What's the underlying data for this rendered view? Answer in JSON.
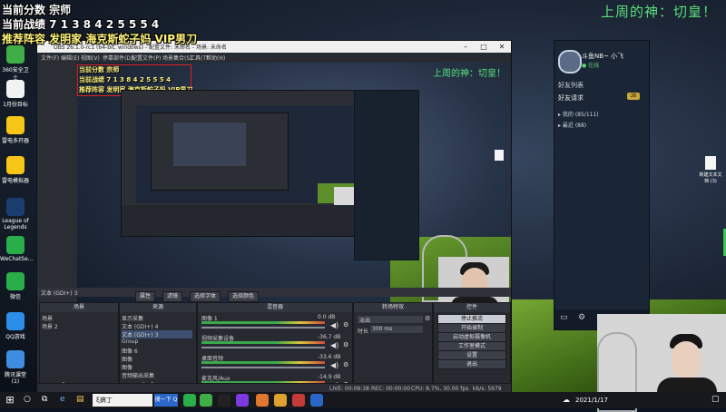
{
  "overlay": {
    "line1": "当前分数 宗师",
    "line2": "当前战绩 7 1 3 8 4 2 5 5 5 4",
    "line3": "推荐阵容 发明家 海克斯蛇子妈 VIP男刀",
    "slogan": "上周的神：切皇！"
  },
  "desktop_icons": [
    {
      "label": "360安全卫士",
      "icon": "security-icon",
      "color": "#3fae47"
    },
    {
      "label": "1月份目标",
      "icon": "document-icon",
      "color": "#f2f2f2"
    },
    {
      "label": "雷电多开器",
      "icon": "emulator-icon",
      "color": "#f5c518"
    },
    {
      "label": "雷电模拟器",
      "icon": "emulator-icon",
      "color": "#f5c518"
    },
    {
      "label": "League of Legends",
      "icon": "league-icon",
      "color": "#1b3d6e"
    },
    {
      "label": "WeChatSe...",
      "icon": "wechat-icon",
      "color": "#2aae4a"
    },
    {
      "label": "微信",
      "icon": "wechat-icon",
      "color": "#2aae4a"
    },
    {
      "label": "QQ游戏",
      "icon": "qq-icon",
      "color": "#2c8ee8"
    },
    {
      "label": "腾讯课堂 (1)",
      "icon": "app-icon",
      "color": "#3e8de0"
    }
  ],
  "obs": {
    "title": "OBS 26.1.0-rc1 (64-bit, windows) - 配置文件: 未命名 - 场景: 未命名",
    "menu": [
      "文件(F)",
      "编辑(E)",
      "视图(V)",
      "停靠部件(D)",
      "配置文件(P)",
      "场景集合(S)",
      "工具(T)",
      "帮助(H)"
    ],
    "source_label": "文本 (GDI+) 3",
    "dock_buttons": [
      "属性",
      "滤镜",
      "选择字体",
      "选择颜色"
    ],
    "scenes": {
      "title": "场景",
      "items": [
        "场景",
        "场景 2"
      ]
    },
    "sources": {
      "title": "来源",
      "items": [
        "显示采集",
        "文本 (GDI+) 4",
        "文本 (GDI+) 3",
        "Group",
        "图像 6",
        "图像",
        "图像",
        "音频输出采集"
      ]
    },
    "mixer": {
      "title": "混音器",
      "channels": [
        {
          "name": "图像 1",
          "db": "0.0 dB"
        },
        {
          "name": "视频采集设备",
          "db": "-36.7 dB"
        },
        {
          "name": "桌面音频",
          "db": "-33.6 dB"
        },
        {
          "name": "麦克风/Aux",
          "db": "-14.9 dB"
        }
      ]
    },
    "transitions": {
      "title": "转场特效",
      "mode": "淡出",
      "duration_label": "时长",
      "duration": "300 ms"
    },
    "controls": {
      "title": "控件",
      "buttons": [
        "停止推流",
        "开始录制",
        "启动虚拟摄像机",
        "工作室模式",
        "设置",
        "退出"
      ]
    },
    "status": {
      "live": "LIVE: 00:08:38",
      "rec": "REC: 00:00:00",
      "cpu": "CPU: 8.7%, 30.00 fps",
      "kbps": "kb/s: 5979"
    }
  },
  "chat": {
    "name": "斗鱼NB~ 小飞",
    "status": "● 在线",
    "tab": "好友列表",
    "sub": "好友请求",
    "badge": "26",
    "groups": [
      "▸ 我的 (85/111)",
      "▸ 最近 (88)"
    ]
  },
  "taskbar": {
    "search_value": "ξ搞丁",
    "search_button": "搜一下 Q",
    "clock": "2021/1/17"
  },
  "right_file_label": "新建文本文档 (3)"
}
